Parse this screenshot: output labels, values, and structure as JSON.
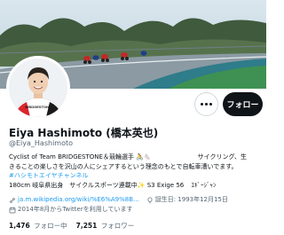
{
  "profile": {
    "display_name": "Eiya Hashimoto (橋本英也)",
    "handle": "@Eiya_Hashimoto"
  },
  "avatar": {
    "jersey_text": "BRIDGESTONE"
  },
  "actions": {
    "follow_label": "フォロー"
  },
  "bio": {
    "line1_a": "Cyclist of Team BRIDGESTONE＆競輪選手 🚴🐁",
    "line1_b": "サイクリング、生",
    "line2": "きることの楽しさを沢山の人にシェアするという理念のもとで自転車漕いでます。",
    "hashtag": "#ハシモトエイヤチャンネル",
    "line4_a": "180cm 岐阜県出身　サイクルスポーツ連載中✨",
    "line4_b": "S3 Exige 56",
    "line4_c": "ｴｷﾞｰｼﾞｬﾝ"
  },
  "meta": {
    "link_text": "ja.m.wikipedia.org/wiki/%E6%A9%8B...",
    "birthday": "誕生日: 1993年12月15日",
    "joined": "2014年8月からTwitterを利用しています"
  },
  "counts": {
    "following_value": "1,476",
    "following_label": "フォロー中",
    "followers_value": "7,251",
    "followers_label": "フォロワー"
  },
  "colors": {
    "link_blue": "#1d9bf0",
    "primary_text": "#0f1419",
    "secondary_text": "#536471",
    "button_black": "#0f1419"
  }
}
